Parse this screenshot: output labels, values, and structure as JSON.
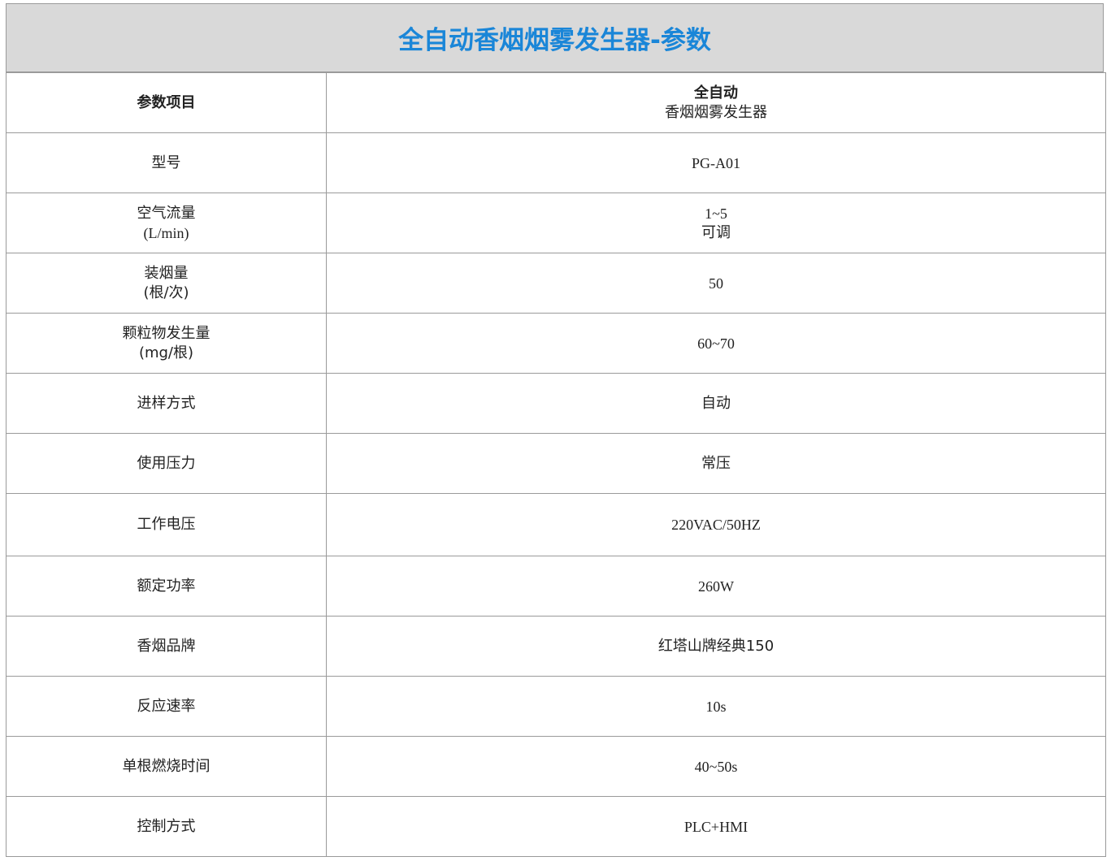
{
  "title": "全自动香烟烟雾发生器-参数",
  "header": {
    "label": "参数项目",
    "value_line1": "全自动",
    "value_line2": "香烟烟雾发生器"
  },
  "rows": [
    {
      "label": [
        "型号"
      ],
      "value": [
        "PG-A01"
      ]
    },
    {
      "label": [
        "空气流量",
        "(L/min)"
      ],
      "value": [
        "1~5",
        "可调"
      ]
    },
    {
      "label": [
        "装烟量",
        "(根/次)"
      ],
      "value": [
        "50"
      ]
    },
    {
      "label": [
        "颗粒物发生量",
        "(mg/根)"
      ],
      "value": [
        "60~70"
      ]
    },
    {
      "label": [
        "进样方式"
      ],
      "value": [
        "自动"
      ]
    },
    {
      "label": [
        "使用压力"
      ],
      "value": [
        "常压"
      ]
    },
    {
      "label": [
        "工作电压"
      ],
      "value": [
        "220VAC/50HZ"
      ]
    },
    {
      "label": [
        "额定功率"
      ],
      "value": [
        "260W"
      ]
    },
    {
      "label": [
        "香烟品牌"
      ],
      "value": [
        "红塔山牌经典150"
      ]
    },
    {
      "label": [
        "反应速率"
      ],
      "value": [
        "10s"
      ]
    },
    {
      "label": [
        "单根燃烧时间"
      ],
      "value": [
        "40~50s"
      ]
    },
    {
      "label": [
        "控制方式"
      ],
      "value": [
        "PLC+HMI"
      ]
    }
  ]
}
